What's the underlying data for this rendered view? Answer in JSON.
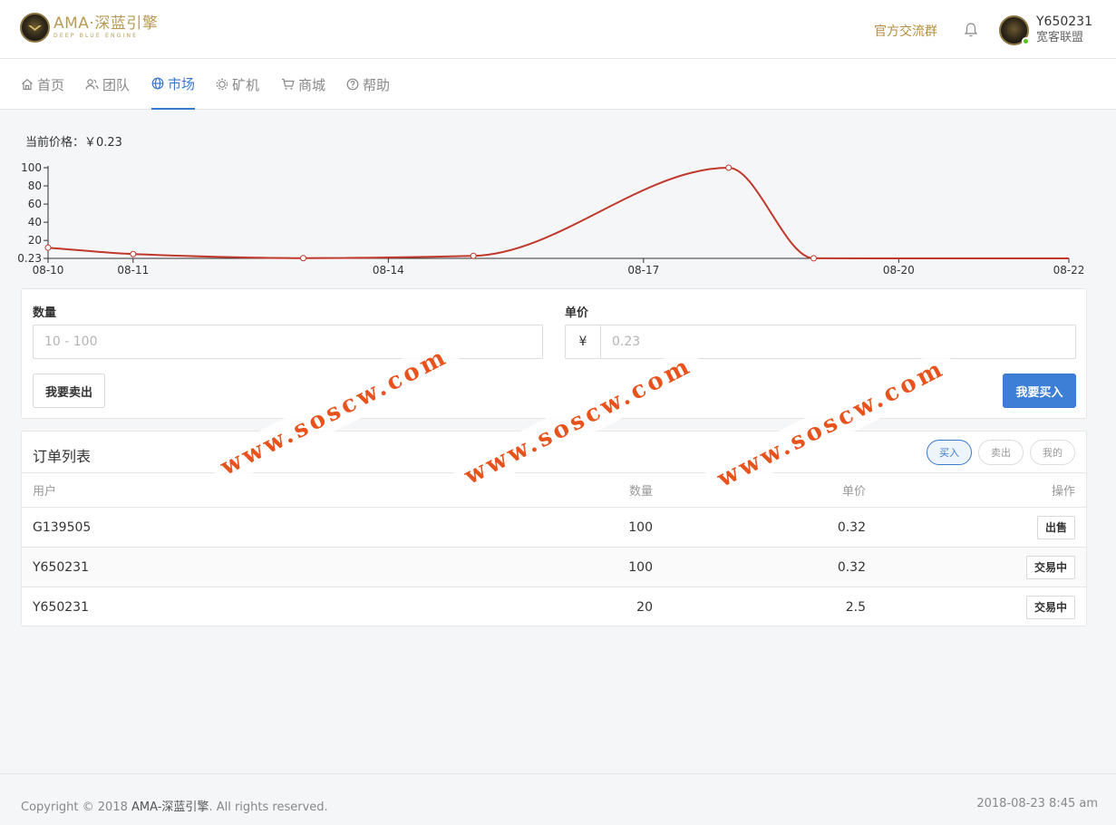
{
  "header": {
    "logo_title": "AMA·深蓝引擎",
    "logo_subtitle": "DEEP BLUE ENGINE",
    "group_link": "官方交流群",
    "user_name": "Y650231",
    "user_team": "宽客联盟"
  },
  "nav": {
    "items": [
      {
        "label": "首页",
        "icon": "home-icon"
      },
      {
        "label": "团队",
        "icon": "team-icon"
      },
      {
        "label": "市场",
        "icon": "globe-icon",
        "active": true
      },
      {
        "label": "矿机",
        "icon": "chip-icon"
      },
      {
        "label": "商城",
        "icon": "cart-icon"
      },
      {
        "label": "帮助",
        "icon": "help-icon"
      }
    ]
  },
  "market": {
    "price_label": "当前价格：￥0.23"
  },
  "chart_data": {
    "type": "line",
    "x": [
      "08-10",
      "08-11",
      "08-13",
      "08-15",
      "08-18",
      "08-19",
      "08-22"
    ],
    "values": [
      12,
      5,
      0.5,
      3,
      100,
      0.3,
      0.23
    ],
    "markers": [
      true,
      true,
      true,
      true,
      true,
      true,
      false
    ],
    "xticks": [
      "08-10",
      "08-11",
      "08-14",
      "08-17",
      "08-20",
      "08-22"
    ],
    "yticks": [
      "0.23",
      "20",
      "40",
      "60",
      "80",
      "100"
    ],
    "ylim": [
      0.23,
      100
    ],
    "color": "#c0392b",
    "grid": false
  },
  "trade": {
    "quantity_label": "数量",
    "quantity_placeholder": "10 - 100",
    "price_label": "单价",
    "price_prefix": "¥",
    "price_placeholder": "0.23",
    "sell_button": "我要卖出",
    "buy_button": "我要买入"
  },
  "orders": {
    "title": "订单列表",
    "filters": [
      "买入",
      "卖出",
      "我的"
    ],
    "columns": {
      "user": "用户",
      "qty": "数量",
      "price": "单价",
      "op": "操作"
    },
    "rows": [
      {
        "user": "G139505",
        "qty": "100",
        "price": "0.32",
        "op": "出售"
      },
      {
        "user": "Y650231",
        "qty": "100",
        "price": "0.32",
        "op": "交易中"
      },
      {
        "user": "Y650231",
        "qty": "20",
        "price": "2.5",
        "op": "交易中"
      }
    ]
  },
  "footer": {
    "copyright_prefix": "Copyright © 2018 ",
    "copyright_brand": "AMA-深蓝引擎",
    "copyright_suffix": ". All rights reserved.",
    "time": "2018-08-23 8:45 am"
  },
  "watermark": "www.soscw.com"
}
